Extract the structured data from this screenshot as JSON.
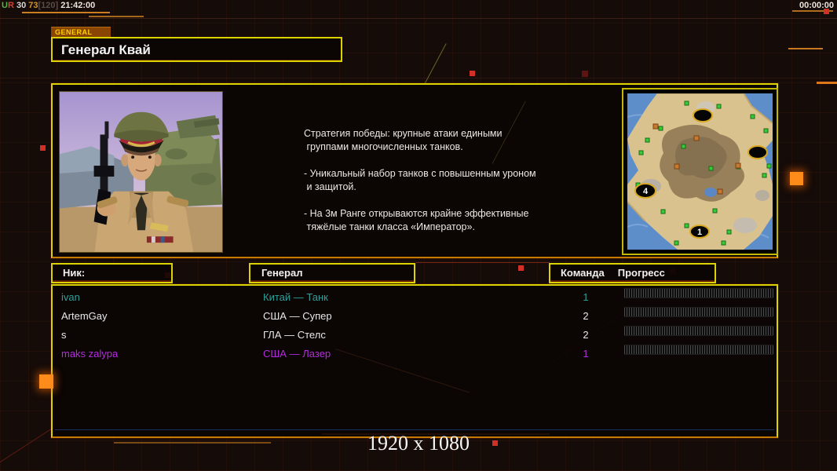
{
  "colors": {
    "accent_yellow": "#ddd303",
    "accent_orange": "#ff8c1a",
    "team_teal": "#2fa09a",
    "team_magenta": "#b42ce0",
    "text_white": "#e8e8e8"
  },
  "top_bar": {
    "perf_segments": [
      {
        "text": "U",
        "color": "#55b44a"
      },
      {
        "text": "R",
        "color": "#cf4434"
      },
      {
        "text": " 30 ",
        "color": "#d8d8d8"
      },
      {
        "text": "73",
        "color": "#d3962a"
      },
      {
        "text": "[120]",
        "color": "#5c4c44"
      },
      {
        "text": " 21:42:00",
        "color": "#eae4dc"
      }
    ],
    "timer": "00:00:00"
  },
  "general_tab": {
    "label": "GENERAL"
  },
  "title": {
    "text": "Генерал Квай"
  },
  "info_panel": {
    "description": {
      "lines": [
        "Стратегия победы: крупные атаки едиными",
        " группами многочисленных танков.",
        "",
        "- Уникальный набор танков с повышенным уроном",
        " и защитой.",
        "",
        "- На 3м Ранге открываются крайне эффективные",
        " тяжёлые танки класса «Император»."
      ]
    },
    "map_preview": {
      "start_markers": [
        "4",
        "1"
      ]
    }
  },
  "lobby_table": {
    "headers": {
      "nick": "Ник:",
      "general": "Генерал",
      "team": "Команда",
      "progress": "Прогресс"
    },
    "players": [
      {
        "nick": "ivan",
        "general": "Китай — Танк",
        "team": "1",
        "color": "#2fa09a",
        "progress_percent": 0
      },
      {
        "nick": "ArtemGay",
        "general": "США — Супер",
        "team": "2",
        "color": "#e8e8e8",
        "progress_percent": 0
      },
      {
        "nick": "s",
        "general": "ГЛА — Стелс",
        "team": "2",
        "color": "#e8e8e8",
        "progress_percent": 0
      },
      {
        "nick": "maks zalypa",
        "general": "США — Лазер",
        "team": "1",
        "color": "#b42ce0",
        "progress_percent": 0
      }
    ]
  },
  "footer": {
    "resolution": "1920 x 1080"
  }
}
